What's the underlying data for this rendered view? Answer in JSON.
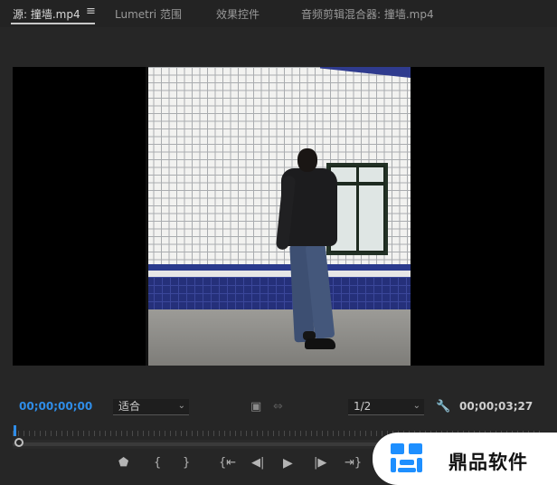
{
  "tabs": [
    {
      "label": "源: 撞墙.mp4",
      "active": true
    },
    {
      "label": "Lumetri 范围",
      "active": false
    },
    {
      "label": "效果控件",
      "active": false
    },
    {
      "label": "音频剪辑混合器: 撞墙.mp4",
      "active": false
    }
  ],
  "tab_menu_icon": "hamburger-menu-icon",
  "controls": {
    "timecode_in": "00;00;00;00",
    "fit_label": "适合",
    "resolution_label": "1/2",
    "timecode_duration": "00;00;03;27",
    "export_frame_icon": "camera-icon",
    "insert_icon": "insert-icon",
    "settings_icon": "wrench-icon"
  },
  "transport": [
    {
      "name": "add-marker-button",
      "icon": "marker-icon",
      "glyph": "⬟"
    },
    {
      "name": "mark-in-button",
      "icon": "mark-in-icon",
      "glyph": "{"
    },
    {
      "name": "mark-out-button",
      "icon": "mark-out-icon",
      "glyph": "}"
    },
    {
      "name": "go-to-in-button",
      "icon": "go-to-in-icon",
      "glyph": "{⇤"
    },
    {
      "name": "step-back-button",
      "icon": "step-back-icon",
      "glyph": "◀|"
    },
    {
      "name": "play-button",
      "icon": "play-icon",
      "glyph": "▶"
    },
    {
      "name": "step-forward-button",
      "icon": "step-forward-icon",
      "glyph": "|▶"
    },
    {
      "name": "go-to-out-button",
      "icon": "go-to-out-icon",
      "glyph": "⇥}"
    }
  ],
  "watermark": {
    "text": "鼎品软件"
  },
  "colors": {
    "accent": "#2f8de8",
    "panel": "#262626"
  }
}
